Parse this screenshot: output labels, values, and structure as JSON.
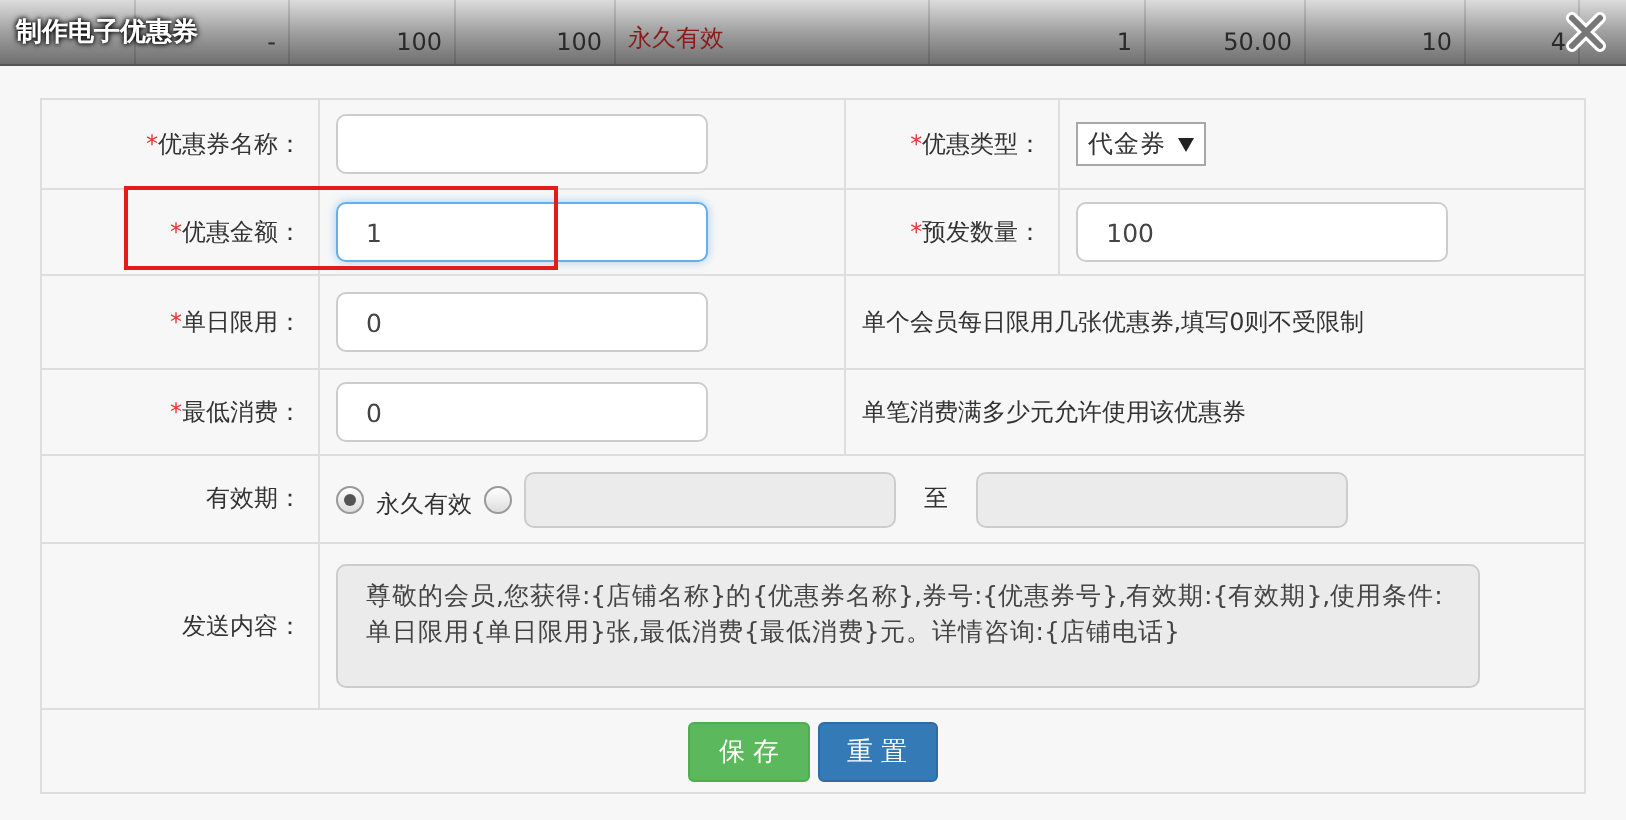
{
  "background_row": [
    {
      "kind": "spacer"
    },
    {
      "text": "-",
      "kind": "plain"
    },
    {
      "text": "100",
      "kind": "plain"
    },
    {
      "text": "100",
      "kind": "plain"
    },
    {
      "text": "永久有效",
      "kind": "status"
    },
    {
      "text": "1",
      "kind": "plain"
    },
    {
      "text": "50.00",
      "kind": "plain"
    },
    {
      "text": "10",
      "kind": "plain"
    },
    {
      "text": "4",
      "kind": "plain"
    }
  ],
  "window": {
    "title": "制作电子优惠券"
  },
  "rows": [
    {
      "kind": "pair",
      "fields": [
        {
          "asterisk": "*",
          "label": "优惠券名称：",
          "kind": "text",
          "focused": false
        },
        {
          "asterisk": "*",
          "label": "优惠类型：",
          "kind": "select",
          "value": "代金券"
        }
      ]
    },
    {
      "kind": "pair",
      "fields": [
        {
          "asterisk": "*",
          "label": "优惠金额：",
          "kind": "text",
          "value": "1",
          "focused": true,
          "highlighted": true
        },
        {
          "asterisk": "*",
          "label": "预发数量：",
          "kind": "text",
          "value": "100",
          "focused": false
        }
      ]
    },
    {
      "kind": "hint",
      "fields": [
        {
          "asterisk": "*",
          "label": "单日限用：",
          "kind": "text",
          "value": "0",
          "focused": false
        }
      ],
      "hint": "单个会员每日限用几张优惠券,填写0则不受限制"
    },
    {
      "kind": "hint",
      "fields": [
        {
          "asterisk": "*",
          "label": "最低消费：",
          "kind": "text",
          "value": "0",
          "focused": false
        }
      ],
      "hint": "单笔消费满多少元允许使用该优惠券"
    }
  ],
  "validity": {
    "label": "有效期：",
    "options": [
      {
        "label": "永久有效",
        "selected": true
      },
      {
        "selected": false
      }
    ],
    "separator": "至"
  },
  "message": {
    "label": "发送内容：",
    "value": "尊敬的会员,您获得:{店铺名称}的{优惠券名称},券号:{优惠券号},有效期:{有效期},使用条件:单日限用{单日限用}张,最低消费{最低消费}元。详情咨询:{店铺电话}"
  },
  "buttons": [
    {
      "label": "保 存",
      "kind": "primary"
    },
    {
      "label": "重 置",
      "kind": "secondary"
    }
  ]
}
